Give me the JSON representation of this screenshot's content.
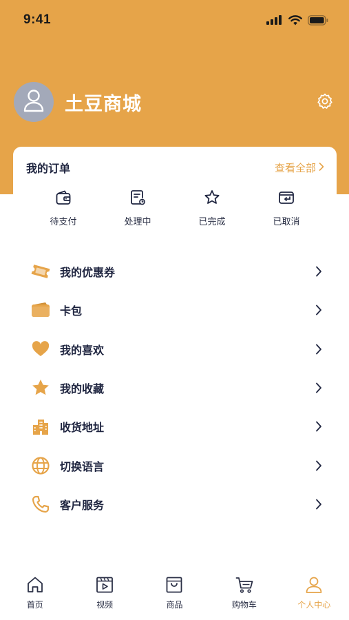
{
  "status_bar": {
    "time": "9:41"
  },
  "profile": {
    "shop_name": "土豆商城"
  },
  "orders": {
    "title": "我的订单",
    "view_all": "查看全部",
    "items": [
      {
        "label": "待支付",
        "icon": "wallet-icon"
      },
      {
        "label": "处理中",
        "icon": "document-icon"
      },
      {
        "label": "已完成",
        "icon": "star-outline-icon"
      },
      {
        "label": "已取消",
        "icon": "return-icon"
      }
    ]
  },
  "menu": [
    {
      "label": "我的优惠券",
      "icon": "coupon-icon"
    },
    {
      "label": "卡包",
      "icon": "card-wallet-icon"
    },
    {
      "label": "我的喜欢",
      "icon": "heart-icon"
    },
    {
      "label": "我的收藏",
      "icon": "star-icon"
    },
    {
      "label": "收货地址",
      "icon": "building-icon"
    },
    {
      "label": "切换语言",
      "icon": "globe-icon"
    },
    {
      "label": "客户服务",
      "icon": "phone-icon"
    }
  ],
  "tabbar": [
    {
      "label": "首页",
      "icon": "home-icon",
      "active": false
    },
    {
      "label": "视频",
      "icon": "video-icon",
      "active": false
    },
    {
      "label": "商品",
      "icon": "shopping-bag-icon",
      "active": false
    },
    {
      "label": "购物车",
      "icon": "cart-icon",
      "active": false
    },
    {
      "label": "个人中心",
      "icon": "user-icon",
      "active": true
    }
  ],
  "colors": {
    "accent": "#e6a449",
    "text": "#1f2540",
    "avatar_bg": "#a3a9b9"
  }
}
